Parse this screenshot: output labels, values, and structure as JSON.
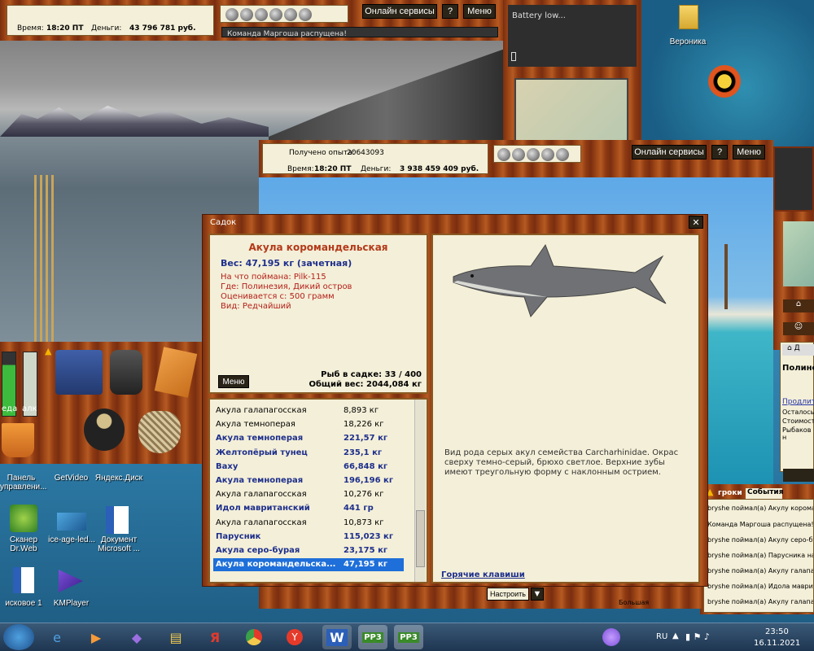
{
  "top_window": {
    "time_label": "Время:",
    "time": "18:20 ПТ",
    "money_label": "Деньги:",
    "money": "43 796 781 руб.",
    "online_btn": "Онлайн сервисы",
    "help_btn": "?",
    "menu_btn": "Меню",
    "message": "Команда Маргоша распущена!"
  },
  "battery": {
    "text": "Battery low..."
  },
  "desktop_top_icon": {
    "label": "Вероника"
  },
  "second_window": {
    "exp_label": "Получено опыта:",
    "exp": "20643093",
    "time_label": "Время:",
    "time": "18:20 ПТ",
    "money_label": "Деньги:",
    "money": "3 938 459 409 руб.",
    "online_btn": "Онлайн сервисы",
    "help_btn": "?",
    "menu_btn": "Меню"
  },
  "left_panel": {
    "label1": "еда",
    "label2": "алк"
  },
  "sadok": {
    "title": "Садок",
    "close": "✕",
    "fish_name": "Акула коромандельская",
    "weight_line": "Вес: 47,195 кг (зачетная)",
    "caught_on": "На что поймана: Pilk-115",
    "where": "Где: Полинезия, Дикий остров",
    "valued_from": "Оценивается с: 500 грамм",
    "kind": "Вид: Редчайший",
    "menu_btn": "Меню",
    "fish_count": "Рыб в садке: 33 / 400",
    "total_weight": "Общий вес: 2044,084 кг",
    "description": "Вид рода серых акул семейства Carcharhinidae. Окрас сверху темно-серый, брюхо светлое. Верхние зубы имеют треугольную форму с наклонным острием.",
    "hotkeys": "Горячие клавиши",
    "list": [
      {
        "name": "Акула галапагосская",
        "weight": "8,893 кг",
        "bold": false,
        "selected": false
      },
      {
        "name": "Акула темноперая",
        "weight": "18,226 кг",
        "bold": false,
        "selected": false
      },
      {
        "name": "Акула темноперая",
        "weight": "221,57 кг",
        "bold": true,
        "selected": false
      },
      {
        "name": "Желтопёрый тунец",
        "weight": "235,1 кг",
        "bold": true,
        "selected": false
      },
      {
        "name": "Ваху",
        "weight": "66,848 кг",
        "bold": true,
        "selected": false
      },
      {
        "name": "Акула темноперая",
        "weight": "196,196 кг",
        "bold": true,
        "selected": false
      },
      {
        "name": "Акула галапагосская",
        "weight": "10,276 кг",
        "bold": false,
        "selected": false
      },
      {
        "name": "Идол мавританский",
        "weight": "441 гр",
        "bold": true,
        "selected": false
      },
      {
        "name": "Акула галапагосская",
        "weight": "10,873 кг",
        "bold": false,
        "selected": false
      },
      {
        "name": "Парусник",
        "weight": "115,023 кг",
        "bold": true,
        "selected": false
      },
      {
        "name": "Акула серо-бурая",
        "weight": "23,175 кг",
        "bold": true,
        "selected": false
      },
      {
        "name": "Акула коромандельска...",
        "weight": "47,195 кг",
        "bold": true,
        "selected": true
      }
    ]
  },
  "right_panel": {
    "tab_home": "Д",
    "heading": "Полине",
    "link": "Продлить",
    "line1": "Осталось",
    "line2": "Стоимость",
    "line3": "Рыбаков н",
    "tab_players": "гроки",
    "tab_events": "События",
    "events": [
      "bryshe поймал(а) Акулу короманд",
      "Команда Маргоша распущена!",
      "bryshe поймал(а) Акулу серо-бур",
      "bryshe поймал(а) Парусника на 1",
      "bryshe поймал(а) Акулу галапаго",
      "bryshe поймал(а) Идола маврита",
      "bryshe поймал(а) Акулу галапаго"
    ]
  },
  "bottom_bits": {
    "setup_btn": "Настроить",
    "big_label": "Большая"
  },
  "desktop_icons": [
    {
      "label": "Панель управлени..."
    },
    {
      "label": "GetVideo"
    },
    {
      "label": "Яндекс.Диск"
    },
    {
      "label": "Сканер Dr.Web"
    },
    {
      "label": "ice-age-led..."
    },
    {
      "label": "Документ Microsoft ..."
    },
    {
      "label": "исковое 1"
    },
    {
      "label": "KMPlayer"
    }
  ],
  "taskbar": {
    "lang": "RU",
    "time": "23:50",
    "date": "16.11.2021",
    "rf1": "РР3",
    "rf2": "РР3",
    "word": "W"
  }
}
